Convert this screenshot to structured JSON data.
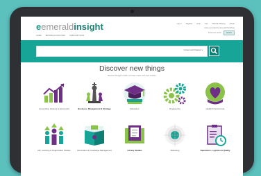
{
  "header": {
    "logo_prefix": "emerald",
    "logo_suffix": "insight",
    "subnav": [
      "HOME",
      "BROWSE & DISCOVER",
      "SUBSCRIPTIONS"
    ],
    "topnav": [
      "Log in",
      "Register",
      "Help",
      "Cart",
      "Website Sharing",
      "Admin"
    ],
    "line1": "Access provided by Emerald Publishing",
    "line2_label": "Advanced search",
    "line2_button": "Search"
  },
  "search": {
    "filter_label": "Content and Chapters",
    "button_icon": "search-icon"
  },
  "main": {
    "title": "Discover new things",
    "subtitle": "Browse through 10,000+ journals, books and case studies"
  },
  "categories": [
    {
      "label": "Accounting, Finance & Economics",
      "icon": "chart-up-icon"
    },
    {
      "label": "Business, Management & Strategy",
      "icon": "chess-icon"
    },
    {
      "label": "Education",
      "icon": "graduation-cap-icon"
    },
    {
      "label": "Engineering",
      "icon": "gears-icon"
    },
    {
      "label": "Health & Social Care",
      "icon": "heart-hand-icon"
    },
    {
      "label": "HR, Learning & Organization Studies",
      "icon": "people-icon"
    },
    {
      "label": "Information & Knowledge Management",
      "icon": "book-icon"
    },
    {
      "label": "Library Studies",
      "icon": "books-icon"
    },
    {
      "label": "Marketing",
      "icon": "target-icon"
    },
    {
      "label": "Operations, Logistics & Quality",
      "icon": "clipboard-clock-icon"
    }
  ],
  "colors": {
    "accent": "#17a597",
    "accent_dark": "#0e7f74",
    "purple": "#6e2f86",
    "green": "#8bc34a",
    "background": "#5cc0bd"
  }
}
